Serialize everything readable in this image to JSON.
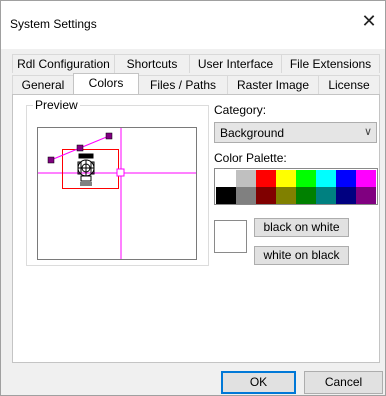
{
  "window": {
    "title": "System Settings",
    "close_glyph": "✕"
  },
  "tabs_row1": [
    {
      "label": "Rdl Configuration"
    },
    {
      "label": "Shortcuts"
    },
    {
      "label": "User Interface"
    },
    {
      "label": "File Extensions"
    }
  ],
  "tabs_row2": [
    {
      "label": "General",
      "active": false
    },
    {
      "label": "Colors",
      "active": true
    },
    {
      "label": "Files / Paths",
      "active": false
    },
    {
      "label": "Raster Image",
      "active": false
    },
    {
      "label": "License",
      "active": false
    }
  ],
  "preview": {
    "group_label": "Preview"
  },
  "category": {
    "label": "Category:",
    "selected": "Background",
    "chevron_icon": "chevron-down-icon"
  },
  "palette": {
    "label": "Color Palette:",
    "row1": [
      "#ffffff",
      "#c0c0c0",
      "#ff0000",
      "#ffff00",
      "#00ff00",
      "#00ffff",
      "#0000ff",
      "#ff00ff"
    ],
    "row2": [
      "#000000",
      "#808080",
      "#800000",
      "#808000",
      "#008000",
      "#008080",
      "#000080",
      "#800080"
    ]
  },
  "selected_color": "#ffffff",
  "buttons": {
    "black_on_white": "black on white",
    "white_on_black": "white on black",
    "ok": "OK",
    "cancel": "Cancel"
  }
}
